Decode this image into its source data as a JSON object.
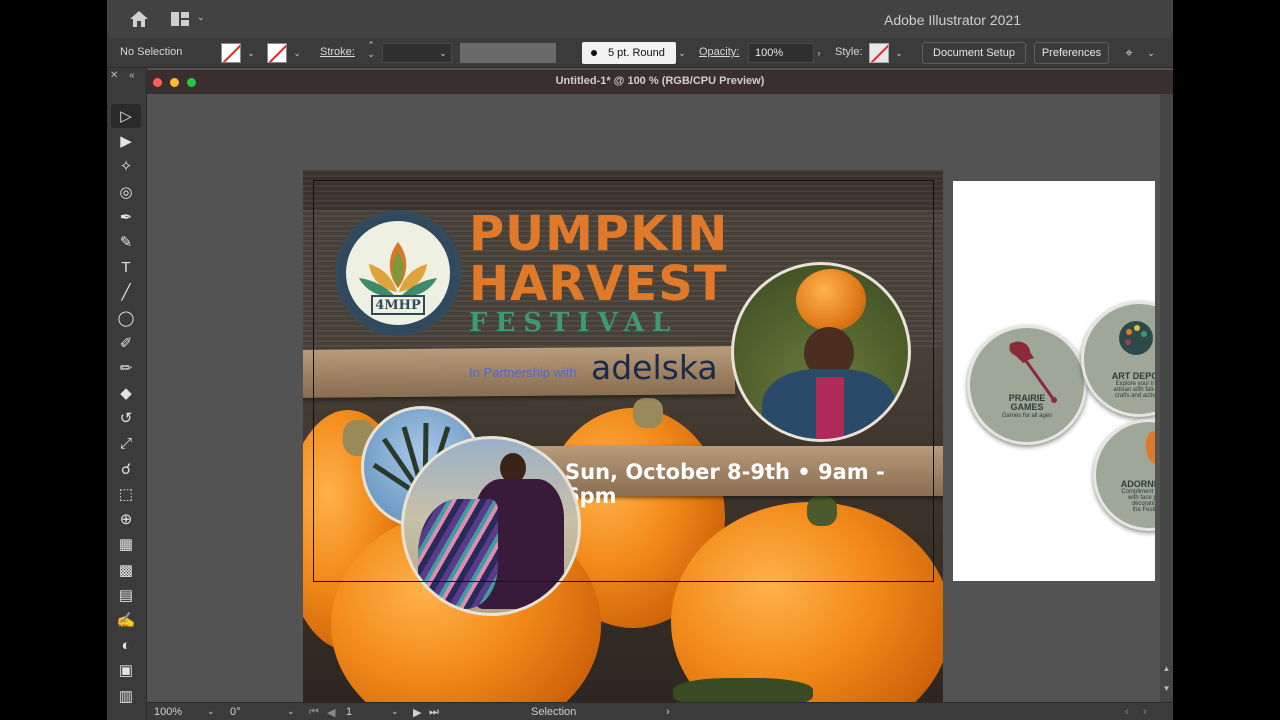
{
  "app": {
    "title": "Adobe Illustrator 2021"
  },
  "control_bar": {
    "selection_status": "No Selection",
    "stroke_label": "Stroke:",
    "brush_label": "5 pt. Round",
    "opacity_label": "Opacity:",
    "opacity_value": "100%",
    "style_label": "Style:",
    "document_setup": "Document Setup",
    "preferences": "Preferences"
  },
  "document": {
    "tab_title": "Untitled-1* @ 100 % (RGB/CPU Preview)"
  },
  "tools": [
    {
      "name": "selection-tool",
      "glyph": "▷"
    },
    {
      "name": "direct-selection-tool",
      "glyph": "▶"
    },
    {
      "name": "magic-wand-tool",
      "glyph": "✧"
    },
    {
      "name": "lasso-tool",
      "glyph": "◎"
    },
    {
      "name": "pen-tool",
      "glyph": "✒"
    },
    {
      "name": "curvature-tool",
      "glyph": "✎"
    },
    {
      "name": "type-tool",
      "glyph": "T"
    },
    {
      "name": "line-segment-tool",
      "glyph": "╱"
    },
    {
      "name": "ellipse-tool",
      "glyph": "◯"
    },
    {
      "name": "shaper-tool",
      "glyph": "✐"
    },
    {
      "name": "pencil-tool",
      "glyph": "✏"
    },
    {
      "name": "eraser-tool",
      "glyph": "◆"
    },
    {
      "name": "rotate-tool",
      "glyph": "↺"
    },
    {
      "name": "scale-tool",
      "glyph": "⤢"
    },
    {
      "name": "warp-tool",
      "glyph": "☌"
    },
    {
      "name": "free-transform-tool",
      "glyph": "⬚"
    },
    {
      "name": "shape-builder-tool",
      "glyph": "⊕"
    },
    {
      "name": "perspective-grid-tool",
      "glyph": "▦"
    },
    {
      "name": "mesh-tool",
      "glyph": "▩"
    },
    {
      "name": "gradient-tool",
      "glyph": "▤"
    },
    {
      "name": "eyedropper-tool",
      "glyph": "✍"
    },
    {
      "name": "blend-tool",
      "glyph": "◐"
    },
    {
      "name": "symbol-sprayer-tool",
      "glyph": "▣"
    },
    {
      "name": "graph-tool",
      "glyph": "▥"
    }
  ],
  "artwork": {
    "logo_text": "4MHP",
    "title_line1": "PUMPKIN",
    "title_line2": "HARVEST",
    "title_line3": "FESTIVAL",
    "partner_text": "In Partnership with",
    "partner_name": "adelska",
    "date_text": "Sun, October 8-9th • 9am - 6pm"
  },
  "artboard2": {
    "badge1_title": "PRAIRIE\nGAMES",
    "badge1_sub": "Games for all ages",
    "badge2_title": "ART DEPO",
    "badge2_sub": "Explore your ir\nartisan with fall-t\ncrafts and activ",
    "badge3_title": "ADORNME",
    "badge3_sub": "Compliment your\nwith face pa\ndecoratio\nthe Festi"
  },
  "status_bar": {
    "zoom": "100%",
    "rotation": "0°",
    "artboard_number": "1",
    "current_tool": "Selection"
  },
  "colors": {
    "pumpkin_orange": "#e07a2a",
    "festival_green": "#3e9a70",
    "partner_blue": "#4a6ad6",
    "stroke_none_red": "#e0272a"
  }
}
